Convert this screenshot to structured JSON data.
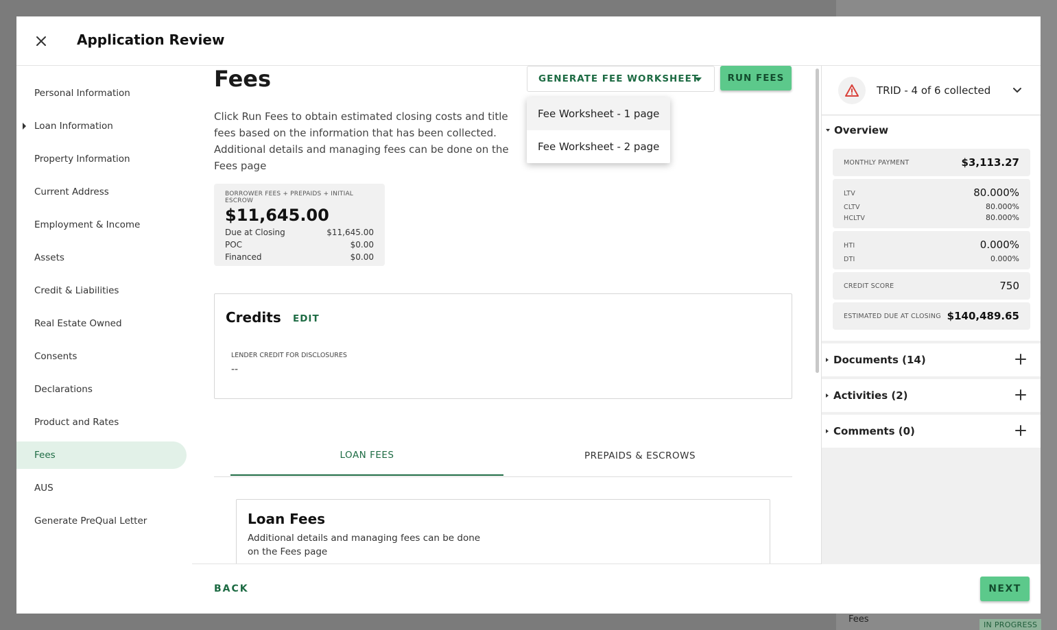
{
  "background": {
    "fees_label": "Fees",
    "status_badge": "IN PROGRESS"
  },
  "modal": {
    "title": "Application Review"
  },
  "nav": {
    "items": [
      {
        "label": "Personal Information"
      },
      {
        "label": "Loan Information"
      },
      {
        "label": "Property Information"
      },
      {
        "label": "Current Address"
      },
      {
        "label": "Employment & Income"
      },
      {
        "label": "Assets"
      },
      {
        "label": "Credit & Liabilities"
      },
      {
        "label": "Real Estate Owned"
      },
      {
        "label": "Consents"
      },
      {
        "label": "Declarations"
      },
      {
        "label": "Product and Rates"
      },
      {
        "label": "Fees"
      },
      {
        "label": "AUS"
      },
      {
        "label": "Generate PreQual Letter"
      }
    ],
    "active_index": 11
  },
  "main": {
    "title": "Fees",
    "description": "Click Run Fees to obtain estimated closing costs and title fees based on the information that has been collected. Additional details and managing fees can be done on the Fees page",
    "generate_button": "GENERATE FEE WORKSHEET",
    "run_button": "RUN FEES",
    "dropdown": {
      "options": [
        "Fee Worksheet - 1 page",
        "Fee Worksheet - 2 page"
      ]
    },
    "fee_summary": {
      "kicker": "BORROWER FEES + PREPAIDS + INITIAL ESCROW",
      "total": "$11,645.00",
      "rows": [
        {
          "label": "Due at Closing",
          "value": "$11,645.00"
        },
        {
          "label": "POC",
          "value": "$0.00"
        },
        {
          "label": "Financed",
          "value": "$0.00"
        }
      ]
    },
    "credits": {
      "title": "Credits",
      "edit": "EDIT",
      "lender_credit_label": "LENDER CREDIT FOR DISCLOSURES",
      "lender_credit_value": "--"
    },
    "tabs": [
      {
        "label": "LOAN FEES"
      },
      {
        "label": "PREPAIDS & ESCROWS"
      }
    ],
    "loan_fees": {
      "title": "Loan Fees",
      "description": "Additional details and managing fees can be done on the Fees page"
    }
  },
  "footer": {
    "back": "BACK",
    "next": "NEXT"
  },
  "right": {
    "trid": "TRID - 4 of 6 collected",
    "overview": {
      "title": "Overview",
      "monthly_payment_label": "MONTHLY PAYMENT",
      "monthly_payment": "$3,113.27",
      "ltv_label": "LTV",
      "ltv": "80.000%",
      "cltv_label": "CLTV",
      "cltv": "80.000%",
      "hcltv_label": "HCLTV",
      "hcltv": "80.000%",
      "hti_label": "HTI",
      "hti": "0.000%",
      "dti_label": "DTI",
      "dti": "0.000%",
      "credit_score_label": "CREDIT SCORE",
      "credit_score": "750",
      "estimated_due_label": "ESTIMATED DUE AT CLOSING",
      "estimated_due": "$140,489.65"
    },
    "documents": "Documents (14)",
    "activities": "Activities (2)",
    "comments": "Comments (0)"
  },
  "colors": {
    "accent": "#1d6b43",
    "button_green": "#5cc98b",
    "active_nav": "#e2f1e8",
    "warning": "#d9413a"
  }
}
